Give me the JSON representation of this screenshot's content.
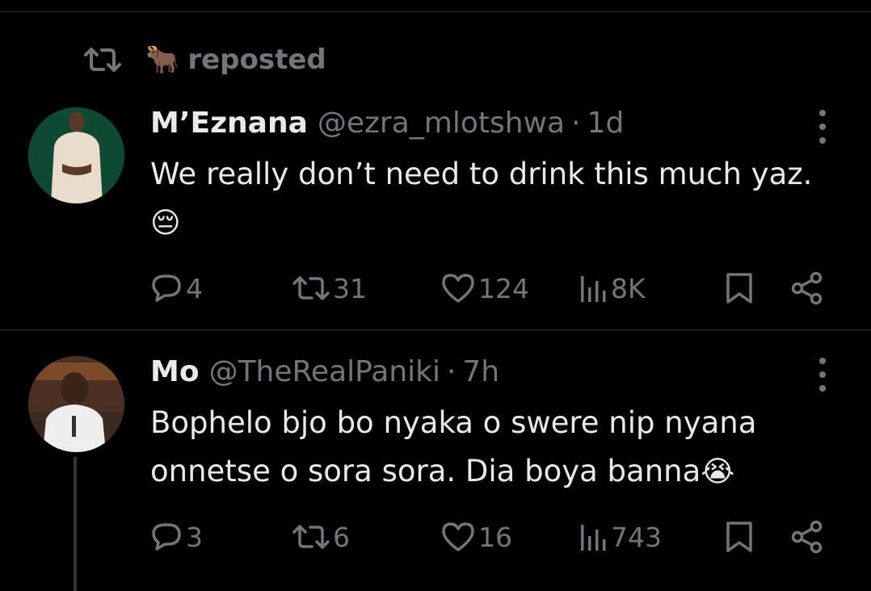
{
  "repost_banner": {
    "icon": "repost-icon",
    "emoji": "🐂",
    "text": "reposted"
  },
  "posts": [
    {
      "name": "M’Eznana",
      "handle": "@ezra_mlotshwa",
      "separator": "·",
      "time": "1d",
      "text": "We really don’t need to drink this much yaz.",
      "emoji": "😔",
      "counts": {
        "replies": "4",
        "reposts": "31",
        "likes": "124",
        "views": "8K"
      }
    },
    {
      "name": "Mo",
      "handle": "@TheRealPaniki",
      "separator": "·",
      "time": "7h",
      "text": "Bophelo bjo bo nyaka o swere nip nyana onnetse o sora sora. Dia boya banna",
      "emoji": "😭",
      "counts": {
        "replies": "3",
        "reposts": "6",
        "likes": "16",
        "views": "743"
      }
    }
  ],
  "colors": {
    "background": "#000000",
    "text": "#e7e9ea",
    "muted": "#71767b",
    "divider": "#2f3336"
  }
}
